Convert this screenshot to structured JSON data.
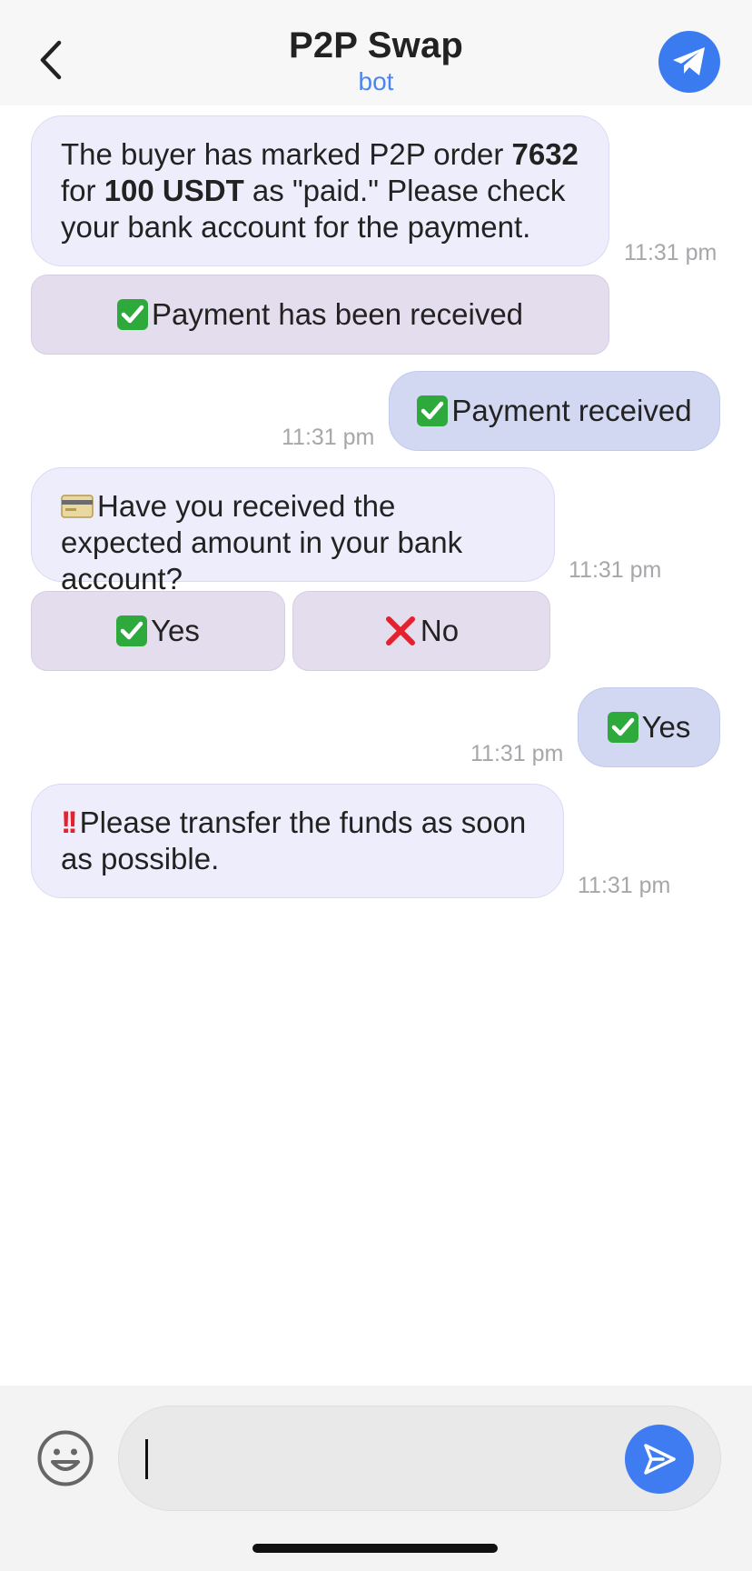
{
  "header": {
    "title": "P2P Swap",
    "subtitle": "bot"
  },
  "messages": [
    {
      "direction": "incoming",
      "text_parts": [
        "The buyer has marked P2P order ",
        "7632",
        " for ",
        "100 USDT",
        " as \"paid.\" Please check your bank account for the payment."
      ],
      "time": "11:31 pm"
    },
    {
      "direction": "keyboard",
      "buttons": [
        {
          "emoji": "check-mark-icon",
          "label": "Payment has been received"
        }
      ]
    },
    {
      "direction": "outgoing",
      "emoji": "check-mark-icon",
      "text": "Payment received",
      "time": "11:31 pm"
    },
    {
      "direction": "incoming",
      "emoji": "credit-card-icon",
      "text": "Have you received the expected amount in your bank account?",
      "time": "11:31 pm"
    },
    {
      "direction": "keyboard",
      "buttons": [
        {
          "emoji": "check-mark-icon",
          "label": "Yes"
        },
        {
          "emoji": "cross-mark-icon",
          "label": "No"
        }
      ]
    },
    {
      "direction": "outgoing",
      "emoji": "check-mark-icon",
      "text": "Yes",
      "time": "11:31 pm"
    },
    {
      "direction": "incoming",
      "emoji": "double-exclamation-icon",
      "text": "Please transfer the funds as soon as possible.",
      "time": "11:31 pm"
    }
  ],
  "composer": {
    "value": ""
  },
  "colors": {
    "accent": "#3f7cf1",
    "incoming_bubble": "#eeedfb",
    "outgoing_bubble": "#d2d8f2",
    "keyboard_button": "#e4dded",
    "timestamp": "#a7a7ab"
  }
}
